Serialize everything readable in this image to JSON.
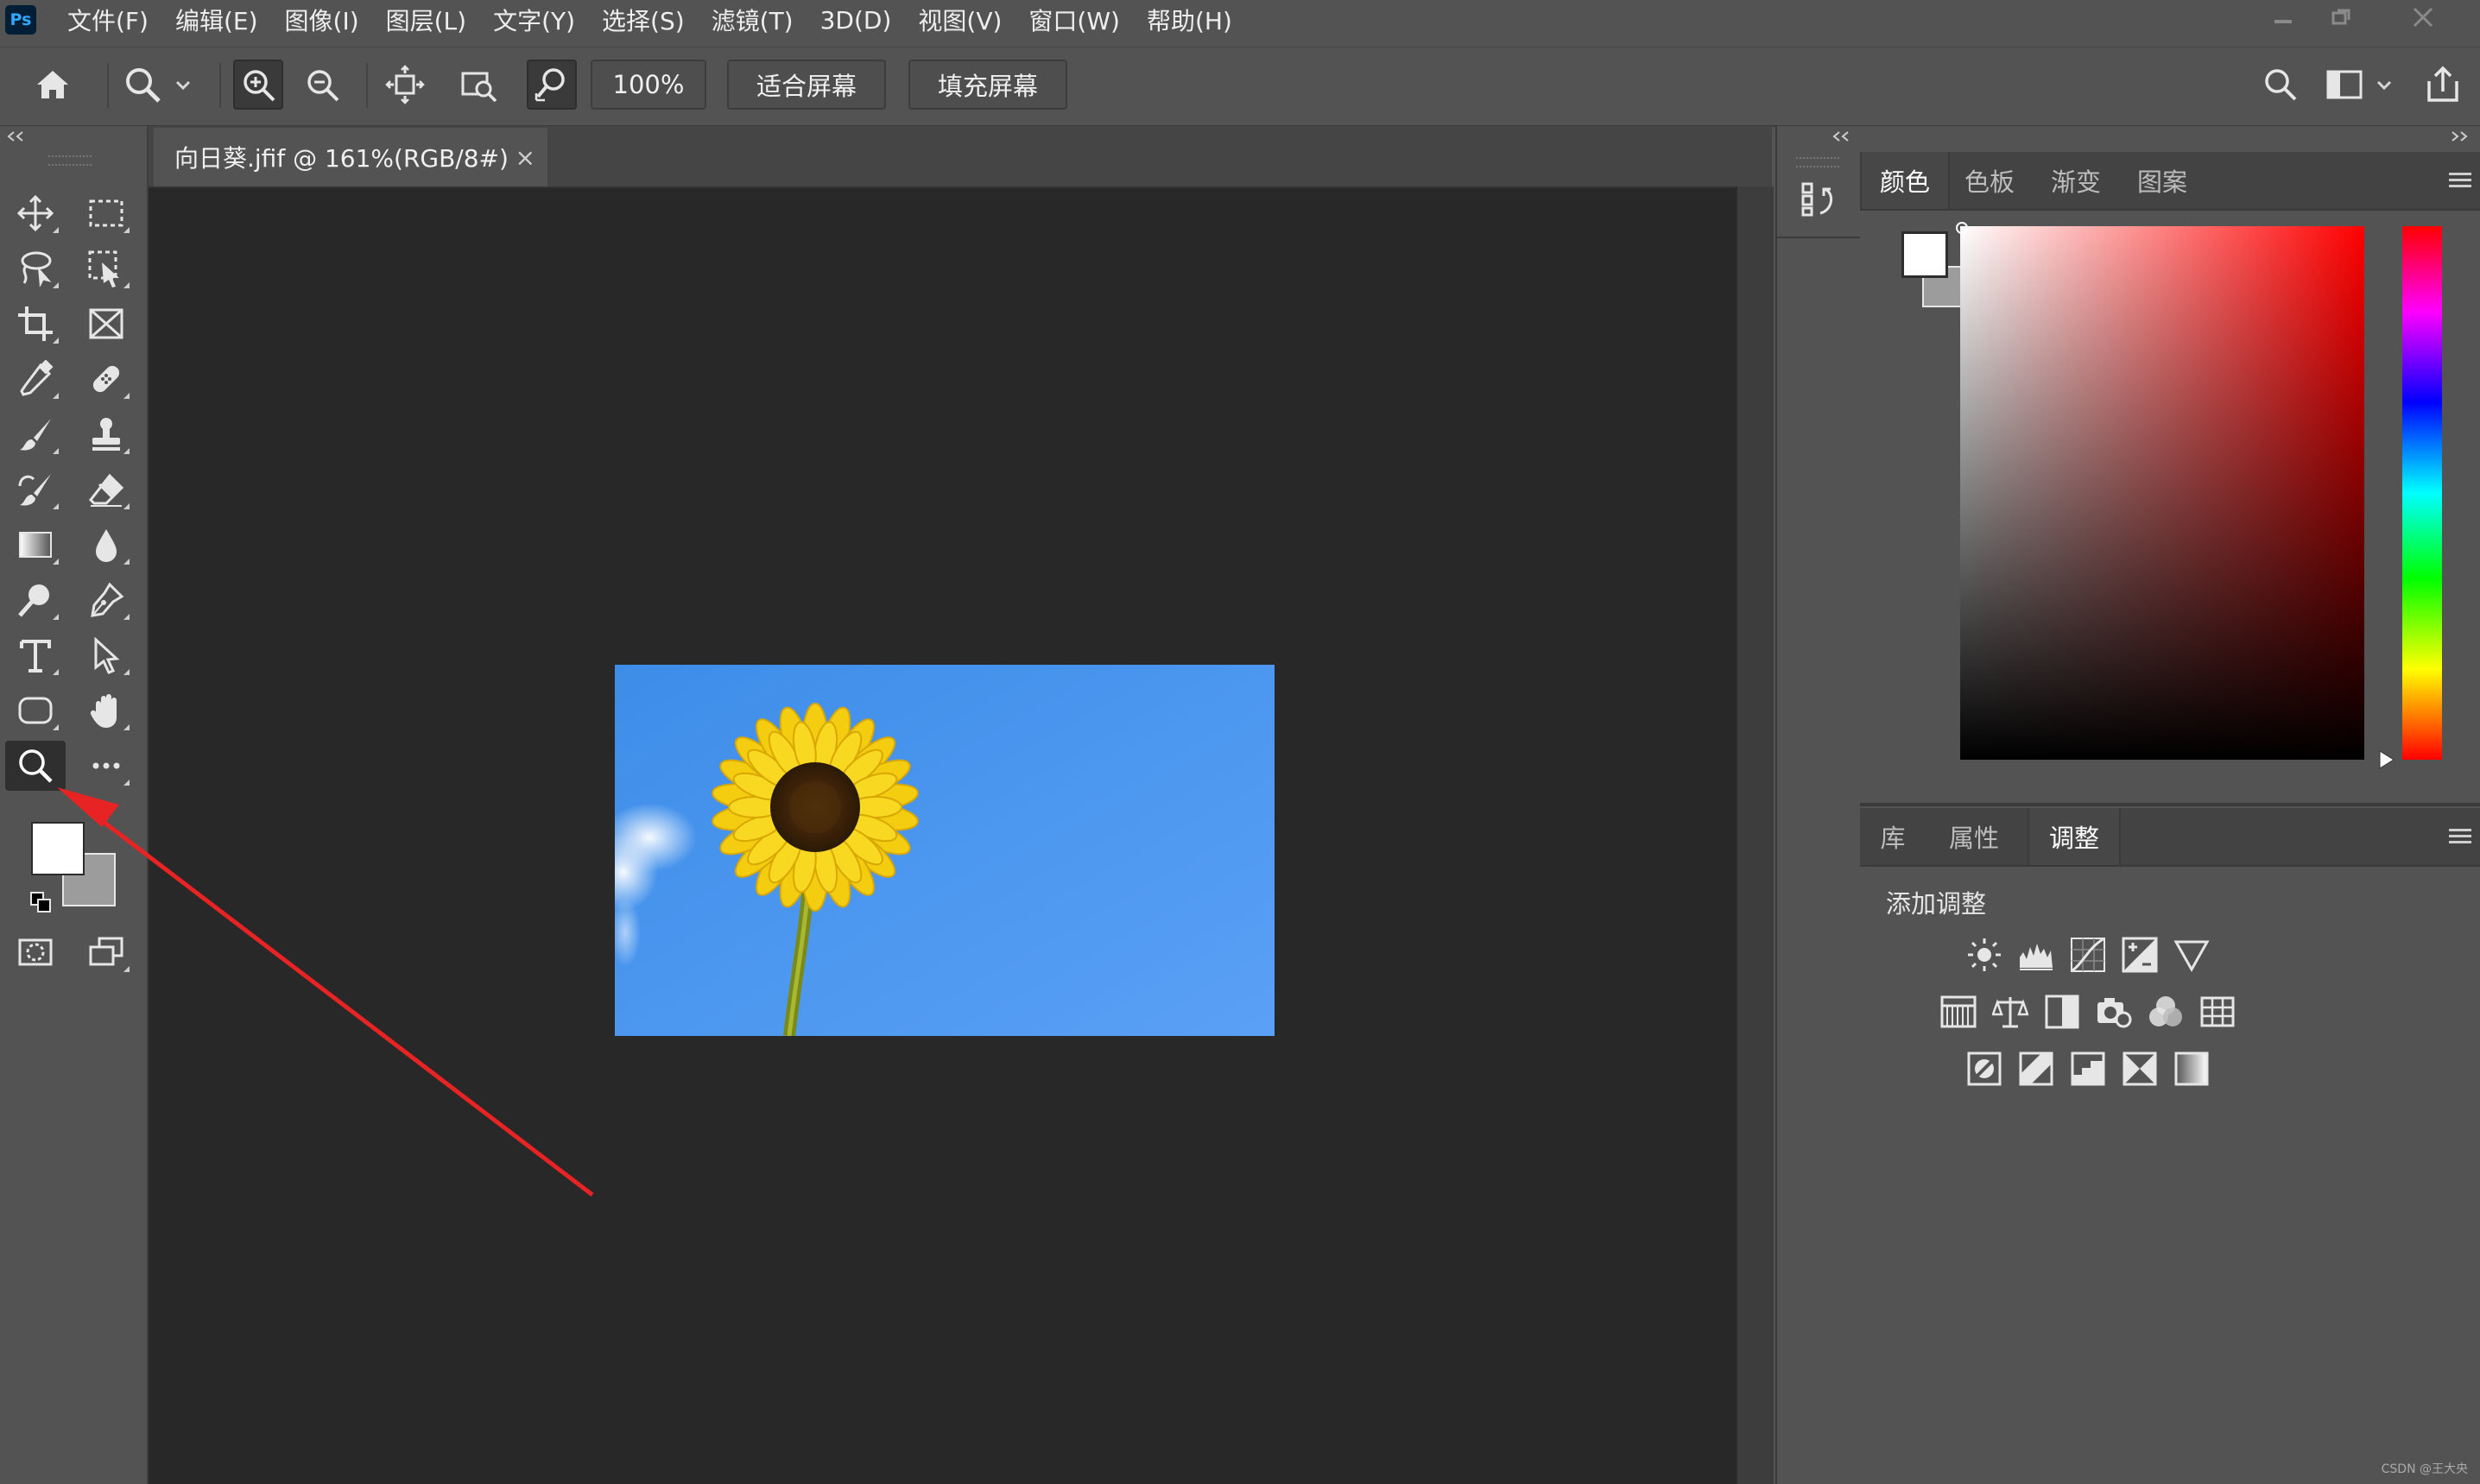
{
  "app": {
    "logo": "Ps",
    "menu": [
      "文件(F)",
      "编辑(E)",
      "图像(I)",
      "图层(L)",
      "文字(Y)",
      "选择(S)",
      "滤镜(T)",
      "3D(D)",
      "视图(V)",
      "窗口(W)",
      "帮助(H)"
    ]
  },
  "options_bar": {
    "zoom_value": "100%",
    "fit_screen_label": "适合屏幕",
    "fill_screen_label": "填充屏幕"
  },
  "document": {
    "tab_title": "向日葵.jfif @ 161%(RGB/8#)",
    "close_glyph": "×"
  },
  "color_panel": {
    "tabs": [
      "颜色",
      "色板",
      "渐变",
      "图案"
    ],
    "active_tab": "颜色",
    "foreground": "#ffffff",
    "background": "#9c9c9c",
    "hue": "#ff0000"
  },
  "adjust_panel": {
    "tabs": [
      "库",
      "属性",
      "调整"
    ],
    "active_tab": "调整",
    "heading": "添加调整",
    "icons_row1": [
      "brightness-icon",
      "levels-icon",
      "curves-icon",
      "exposure-icon",
      "vibrance-icon"
    ],
    "icons_row2": [
      "hue-saturation-icon",
      "color-balance-icon",
      "black-white-icon",
      "photo-filter-icon",
      "channel-mixer-icon",
      "color-lookup-icon"
    ],
    "icons_row3": [
      "invert-icon",
      "posterize-icon",
      "threshold-icon",
      "selective-color-icon",
      "gradient-map-icon"
    ]
  },
  "colors": {
    "accent_arrow": "#e82323",
    "sky": "#4f97f2",
    "canvas_bg": "#282828"
  },
  "watermark": "CSDN @王大央"
}
